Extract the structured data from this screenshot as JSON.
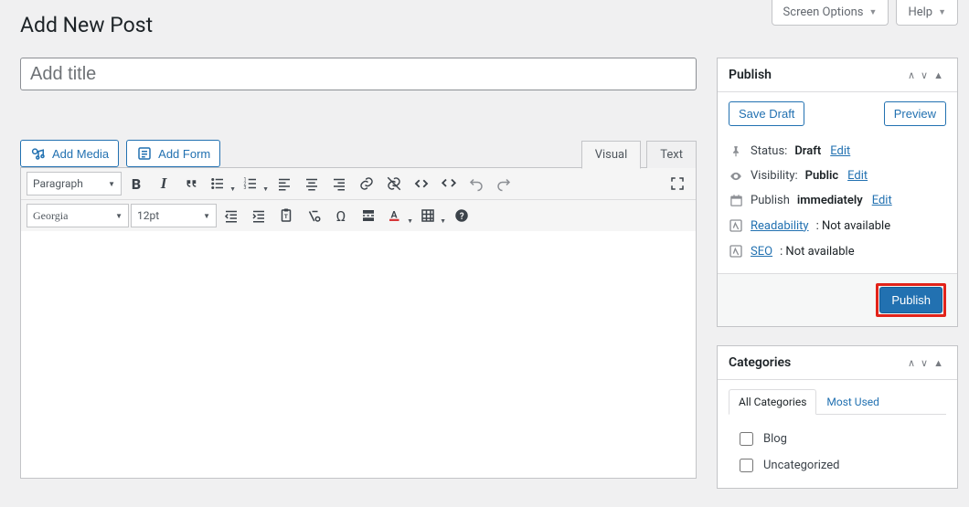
{
  "top": {
    "screen_options": "Screen Options",
    "help": "Help"
  },
  "page_title": "Add New Post",
  "title_placeholder": "Add title",
  "media": {
    "add_media": "Add Media",
    "add_form": "Add Form"
  },
  "ed_tabs": {
    "visual": "Visual",
    "text": "Text"
  },
  "toolbar": {
    "format": "Paragraph",
    "font": "Georgia",
    "size": "12pt"
  },
  "publish": {
    "title": "Publish",
    "save_draft": "Save Draft",
    "preview": "Preview",
    "status_label": "Status:",
    "status_value": "Draft",
    "visibility_label": "Visibility:",
    "visibility_value": "Public",
    "schedule_label": "Publish",
    "schedule_value": "immediately",
    "edit": "Edit",
    "readability_label": "Readability",
    "seo_label": "SEO",
    "not_available": ": Not available",
    "publish_btn": "Publish"
  },
  "categories": {
    "title": "Categories",
    "tabs": {
      "all": "All Categories",
      "most": "Most Used"
    },
    "items": [
      "Blog",
      "Uncategorized"
    ]
  }
}
